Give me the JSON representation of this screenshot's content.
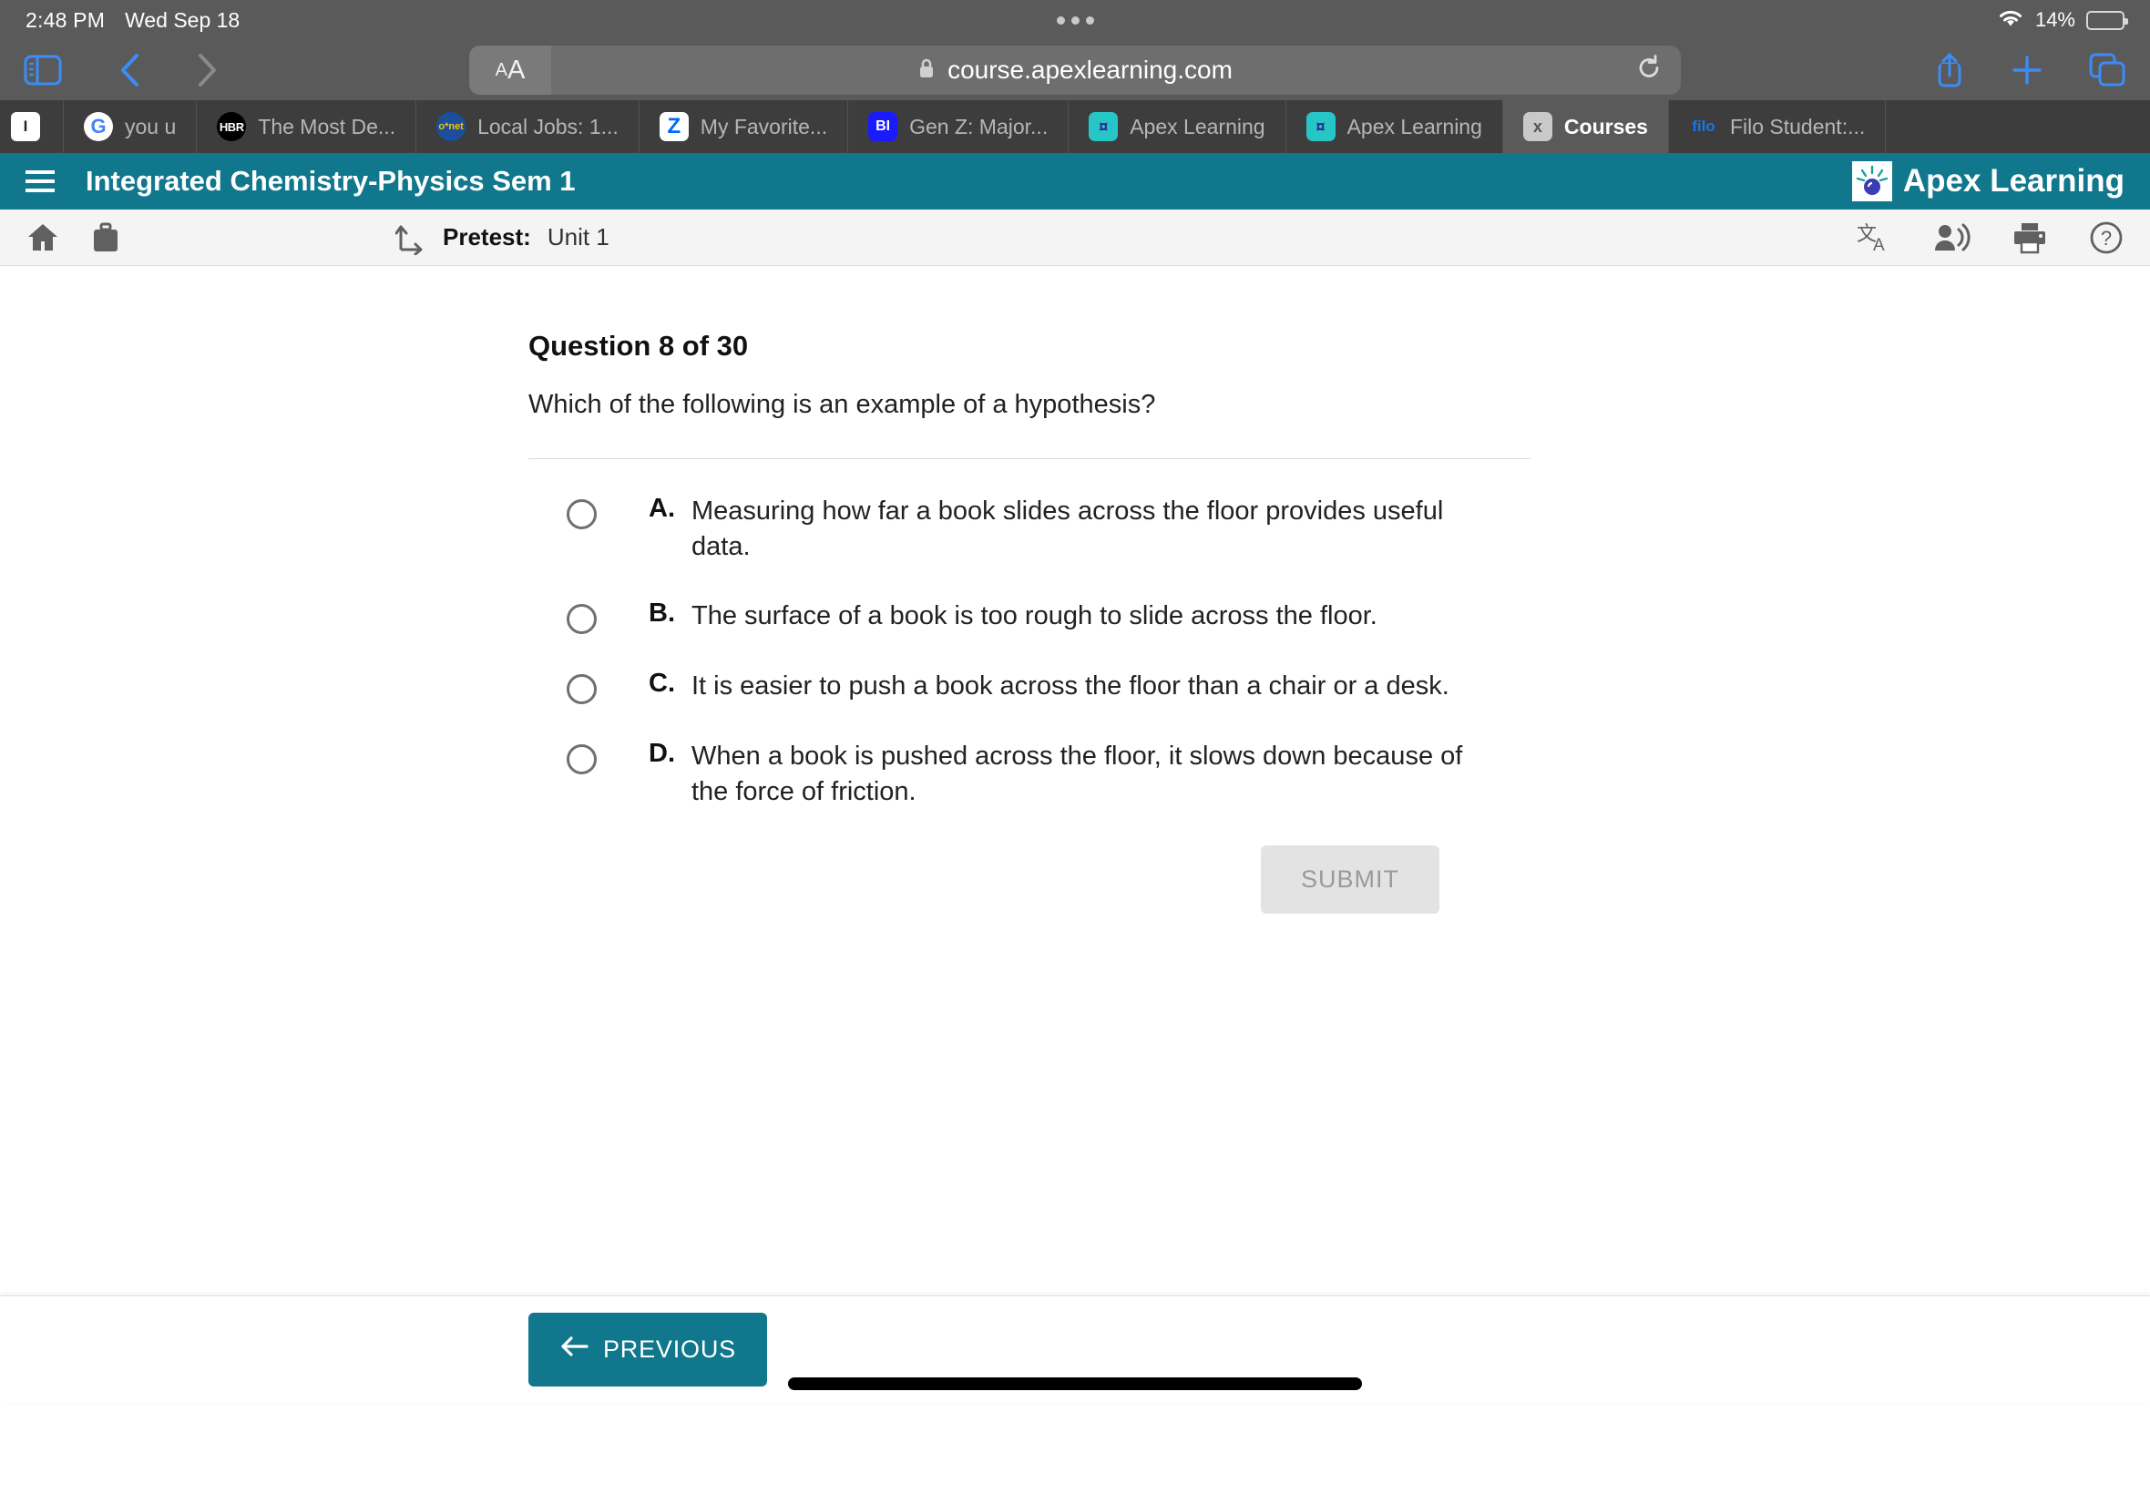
{
  "status_bar": {
    "time": "2:48 PM",
    "date": "Wed Sep 18",
    "battery_percent": "14%",
    "wifi_icon": "wifi-icon",
    "battery_icon": "battery-icon"
  },
  "browser": {
    "sidebar_icon": "sidebar-icon",
    "back_icon": "chevron-left-icon",
    "forward_icon": "chevron-right-icon",
    "aa_small": "A",
    "aa_large": "A",
    "lock_icon": "lock-icon",
    "url": "course.apexlearning.com",
    "reload_icon": "reload-icon",
    "share_icon": "share-icon",
    "new_tab_icon": "plus-icon",
    "tabs_overview_icon": "tabs-icon",
    "tabs": [
      {
        "title": "",
        "favicon": "blank-icon",
        "favicon_text": "I",
        "active": false
      },
      {
        "title": "you u",
        "favicon": "google-icon",
        "favicon_text": "G",
        "active": false
      },
      {
        "title": "The Most De...",
        "favicon": "hbr-icon",
        "favicon_text": "HBR",
        "active": false
      },
      {
        "title": "Local Jobs: 1...",
        "favicon": "onet-icon",
        "favicon_text": "o*net",
        "active": false
      },
      {
        "title": "My Favorite...",
        "favicon": "zillow-icon",
        "favicon_text": "Z",
        "active": false
      },
      {
        "title": "Gen Z: Major...",
        "favicon": "business-insider-icon",
        "favicon_text": "BI",
        "active": false
      },
      {
        "title": "Apex Learning",
        "favicon": "apex-icon",
        "favicon_text": "¤",
        "active": false
      },
      {
        "title": "Apex Learning",
        "favicon": "apex-icon",
        "favicon_text": "¤",
        "active": false
      },
      {
        "title": "Courses",
        "favicon": "x-icon",
        "favicon_text": "x",
        "active": true
      },
      {
        "title": "Filo Student:...",
        "favicon": "filo-icon",
        "favicon_text": "filo",
        "active": false
      }
    ]
  },
  "apex_header": {
    "menu_icon": "hamburger-menu-icon",
    "course_title": "Integrated Chemistry-Physics Sem 1",
    "brand_name": "Apex Learning",
    "brand_trademark": "®",
    "background_color": "#10778c"
  },
  "sub_toolbar": {
    "home_icon": "home-icon",
    "briefcase_icon": "briefcase-icon",
    "upload_icon": "upload-arrow-icon",
    "activity_label": "Pretest:",
    "activity_value": "Unit 1",
    "translate_icon": "translate-icon",
    "read_aloud_icon": "read-aloud-icon",
    "print_icon": "print-icon",
    "help_icon": "help-icon"
  },
  "question": {
    "heading": "Question 8 of 30",
    "number": 8,
    "total": 30,
    "prompt": "Which of the following is an example of a hypothesis?",
    "choices": [
      {
        "letter": "A.",
        "text": "Measuring how far a book slides across the floor provides useful data.",
        "selected": false
      },
      {
        "letter": "B.",
        "text": "The surface of a book is too rough to slide across the floor.",
        "selected": false
      },
      {
        "letter": "C.",
        "text": "It is easier to push a book across the floor than a chair or a desk.",
        "selected": false
      },
      {
        "letter": "D.",
        "text": "When a book is pushed across the floor, it slows down because of the force of friction.",
        "selected": false
      }
    ],
    "submit_label": "SUBMIT",
    "submit_enabled": false
  },
  "footer": {
    "previous_label": "PREVIOUS",
    "previous_icon": "arrow-left-icon",
    "previous_color": "#10778c"
  }
}
